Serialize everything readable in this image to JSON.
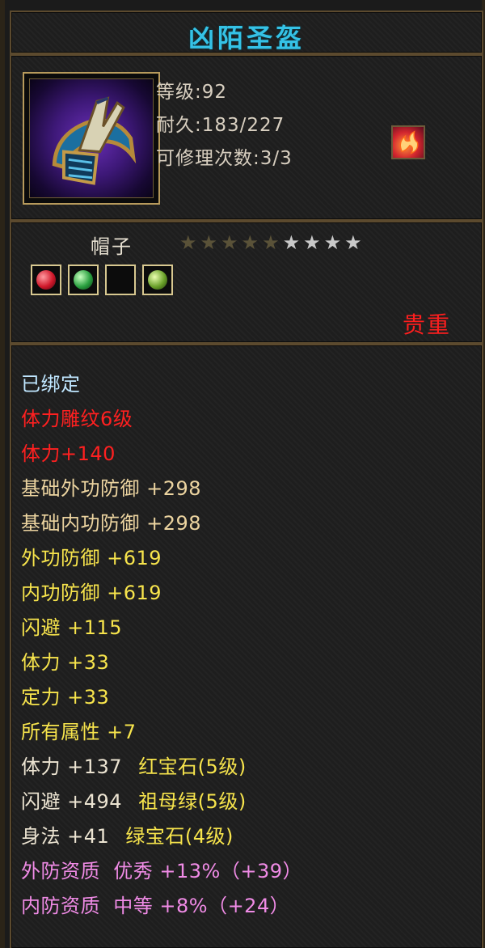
{
  "item": {
    "name": "凶陌圣盔",
    "icon": "helmet-icon",
    "level_text": "等级:92",
    "durability_text": "耐久:183/227",
    "repair_text": "可修理次数:3/3",
    "badge_icon": "flame-crest-icon",
    "type": "帽子",
    "stars": {
      "total": 9,
      "dim": 5,
      "white": 4
    },
    "gem_slots": [
      {
        "icon": "red-gem-icon",
        "filled": true
      },
      {
        "icon": "green-gem-icon",
        "filled": true
      },
      {
        "icon": "empty-slot-icon",
        "filled": false
      },
      {
        "icon": "olive-gem-icon",
        "filled": true
      }
    ],
    "rarity": "贵重"
  },
  "attributes": [
    "已绑定",
    "体力雕纹6级",
    "体力+140",
    "基础外功防御 +298",
    "基础内功防御 +298",
    "外功防御 +619",
    "内功防御 +619",
    "闪避 +115",
    "体力 +33",
    "定力 +33",
    "所有属性 +7",
    "体力 +137 ",
    "闪避 +494 ",
    "身法 +41 ",
    "外防资质  优秀 +13%（+39）",
    "内防资质  中等 +8%（+24）"
  ],
  "gem_attributes": [
    "红宝石(5级)",
    "祖母绿(5级)",
    "绿宝石(4级)"
  ],
  "colors": {
    "title": "#35c2e6",
    "rarity": "#ff1e1e",
    "bind": "#bfe6ff",
    "engrave": "#ff2020",
    "base": "#ecd4a0",
    "bonus": "#f7e44c",
    "aptitude": "#f08be6",
    "frame": "#5c4a2e"
  }
}
